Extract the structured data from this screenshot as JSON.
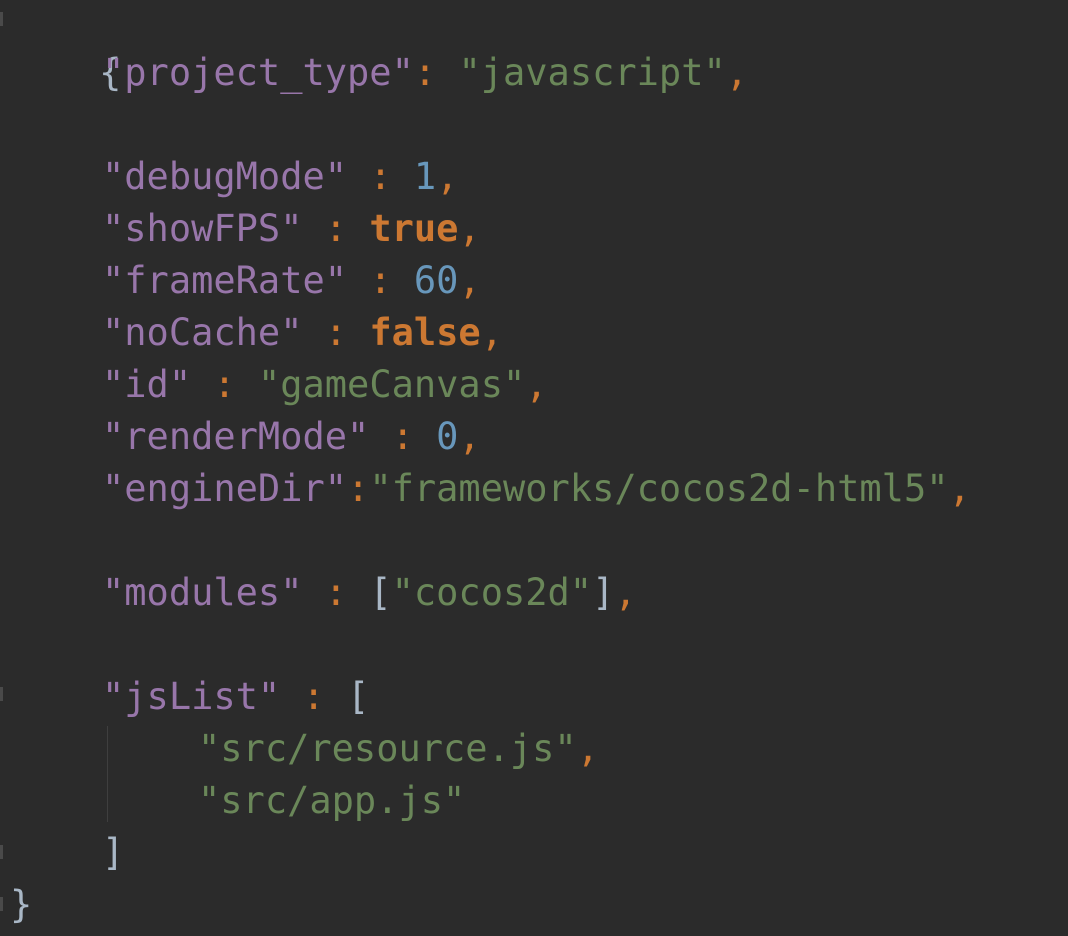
{
  "editor": {
    "lines": [
      {
        "open_brace": "{"
      },
      {
        "key": "\"project_type\"",
        "sep": ": ",
        "value": "\"javascript\"",
        "comma": ","
      },
      {},
      {
        "key": "\"debugMode\"",
        "sep": " : ",
        "value": "1",
        "comma": ","
      },
      {
        "key": "\"showFPS\"",
        "sep": " : ",
        "value": "true",
        "comma": ","
      },
      {
        "key": "\"frameRate\"",
        "sep": " : ",
        "value": "60",
        "comma": ","
      },
      {
        "key": "\"noCache\"",
        "sep": " : ",
        "value": "false",
        "comma": ","
      },
      {
        "key": "\"id\"",
        "sep": " : ",
        "value": "\"gameCanvas\"",
        "comma": ","
      },
      {
        "key": "\"renderMode\"",
        "sep": " : ",
        "value": "0",
        "comma": ","
      },
      {
        "key": "\"engineDir\"",
        "sep": ":",
        "value": "\"frameworks/cocos2d-html5\"",
        "comma": ","
      },
      {},
      {
        "key": "\"modules\"",
        "sep": " : ",
        "bracket_open": "[",
        "value": "\"cocos2d\"",
        "bracket_close": "]",
        "comma": ","
      },
      {},
      {
        "key": "\"jsList\"",
        "sep": " : ",
        "bracket_open": "["
      },
      {
        "value": "\"src/resource.js\"",
        "comma": ","
      },
      {
        "value": "\"src/app.js\""
      },
      {
        "bracket_close": "]"
      },
      {
        "close_brace": "}"
      }
    ]
  },
  "colors": {
    "background": "#2b2b2b",
    "key": "#9876aa",
    "string": "#6a8759",
    "number": "#6897bb",
    "keyword": "#cc7832",
    "text": "#a9b7c6"
  }
}
